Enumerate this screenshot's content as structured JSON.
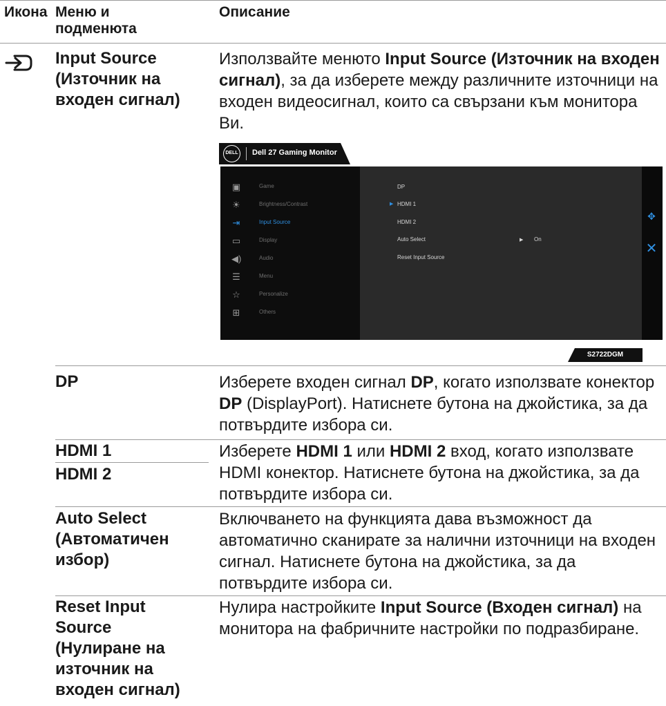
{
  "header": {
    "icon_col": "Икона",
    "menu_col_line1": "Меню и",
    "menu_col_line2": "подменюта",
    "desc_col": "Описание"
  },
  "input_source": {
    "icon": "input-source-icon",
    "title_line1": "Input Source",
    "title_line2": "(Източник на",
    "title_line3": "входен сигнал)",
    "desc_p1": "Използвайте менюто ",
    "desc_b1": "Input Source (Източник на входен сигнал)",
    "desc_p2": ", за да изберете между различните източници на входен видеосигнал, които са свързани към монитора Ви."
  },
  "osd": {
    "logo": "DELL",
    "tab_title": "Dell 27 Gaming Monitor",
    "accent_color": "#2f8fe0",
    "menu": [
      {
        "icon": "game-icon",
        "glyph": "▣",
        "label": "Game"
      },
      {
        "icon": "brightness-icon",
        "glyph": "☀",
        "label": "Brightness/Contrast"
      },
      {
        "icon": "input-source-icon",
        "glyph": "⇥",
        "label": "Input Source",
        "active": true
      },
      {
        "icon": "display-icon",
        "glyph": "▭",
        "label": "Display"
      },
      {
        "icon": "audio-icon",
        "glyph": "◀)",
        "label": "Audio"
      },
      {
        "icon": "menu-icon",
        "glyph": "☰",
        "label": "Menu"
      },
      {
        "icon": "personalize-icon",
        "glyph": "☆",
        "label": "Personalize"
      },
      {
        "icon": "others-icon",
        "glyph": "⊞",
        "label": "Others"
      }
    ],
    "submenu": [
      {
        "label": "DP"
      },
      {
        "label": "HDMI 1",
        "selected": true
      },
      {
        "label": "HDMI 2"
      },
      {
        "label": "Auto Select",
        "value": "On"
      },
      {
        "label": "Reset Input Source"
      }
    ],
    "model": "S2722DGM"
  },
  "rows": {
    "dp": {
      "title": "DP",
      "d1": "Изберете входен сигнал ",
      "b1": "DP",
      "d2": ", когато използвате конектор ",
      "b2": "DP",
      "d3": " (DisplayPort). Натиснете бутона на джойстика, за да потвърдите избора си."
    },
    "hdmi": {
      "title1": "HDMI 1",
      "title2": "HDMI 2",
      "d1": "Изберете ",
      "b1": "HDMI 1",
      "d2": " или ",
      "b2": "HDMI 2",
      "d3": " вход, когато използвате HDMI конектор. Натиснете бутона на джойстика, за да потвърдите избора си."
    },
    "auto": {
      "title_line1": "Auto Select",
      "title_line2": "(Автоматичен",
      "title_line3": "избор)",
      "desc": "Включването на функцията дава възможност да автоматично сканирате за налични източници на входен сигнал. Натиснете бутона на джойстика, за да потвърдите избора си."
    },
    "reset": {
      "title_line1": "Reset Input",
      "title_line2": "Source",
      "title_line3": "(Нулиране на",
      "title_line4": "източник на",
      "title_line5": "входен сигнал)",
      "d1": "Нулира настройките ",
      "b1": "Input Source (Входен сигнал)",
      "d2": " на монитора на фабричните настройки по подразбиране."
    }
  }
}
